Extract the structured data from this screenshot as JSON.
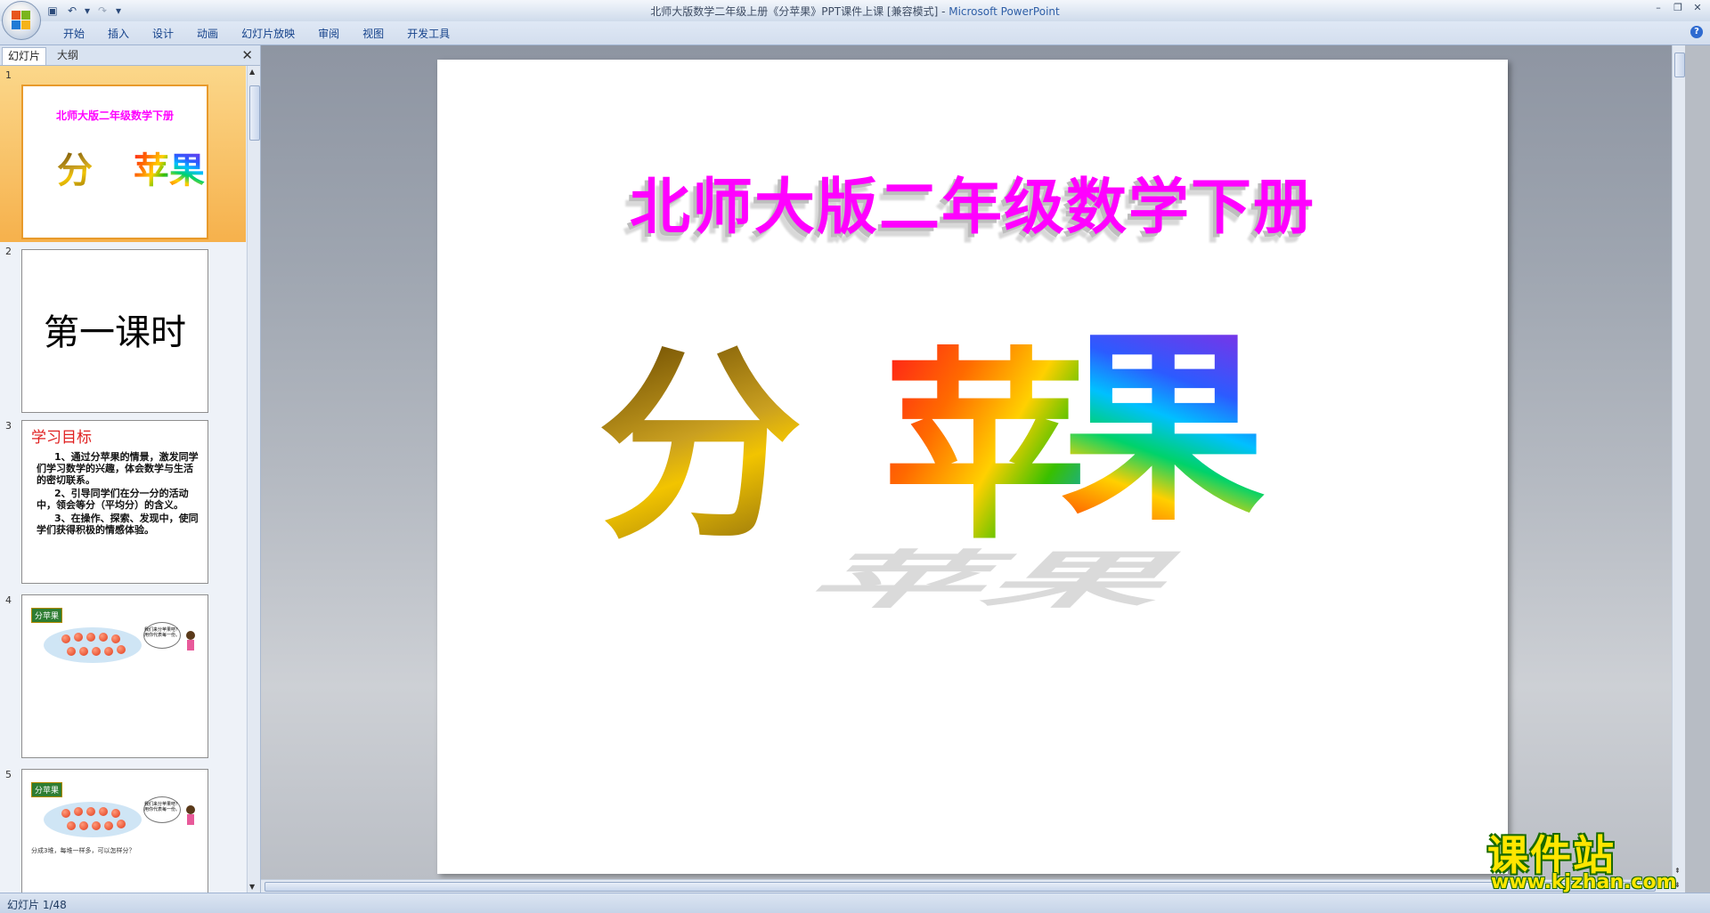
{
  "window": {
    "title": "北师大版数学二年级上册《分苹果》PPT课件上课 [兼容模式]",
    "title_sep": " - ",
    "app_name": "Microsoft PowerPoint"
  },
  "ribbon": {
    "tabs": [
      "开始",
      "插入",
      "设计",
      "动画",
      "幻灯片放映",
      "审阅",
      "视图",
      "开发工具"
    ]
  },
  "left_pane": {
    "tabs": {
      "slides": "幻灯片",
      "outline": "大纲"
    },
    "thumbnails": [
      {
        "number": "1",
        "title": "北师大版二年级数学下册",
        "chars": [
          "分",
          "苹",
          "果"
        ]
      },
      {
        "number": "2",
        "text": "第一课时"
      },
      {
        "number": "3",
        "heading": "学习目标",
        "items": [
          "1、通过分苹果的情景，激发同学们学习数学的兴趣，体会数学与生活的密切联系。",
          "2、引导同学们在分一分的活动中，领会等分（平均分）的含义。",
          "3、在操作、探索、发现中，使同学们获得积极的情感体验。"
        ]
      },
      {
        "number": "4",
        "tag": "分苹果",
        "bubble": "我们来分苹果吧！用你代表每一份。"
      },
      {
        "number": "5",
        "tag": "分苹果",
        "bubble": "我们来分苹果吧！用你代表每一份。",
        "footnote": "分成3堆，每堆一样多，可以怎样分？"
      }
    ]
  },
  "slide": {
    "title": "北师大版二年级数学下册",
    "chars": [
      "分",
      "苹",
      "果"
    ]
  },
  "status": {
    "text": "幻灯片 1/48"
  },
  "watermark": {
    "main": "课件站",
    "url": "www.kjzhan.com"
  },
  "colors": {
    "title_magenta": "#ff00ff",
    "ribbon_text": "#15428b",
    "selected_thumb": "#f6b14c"
  }
}
